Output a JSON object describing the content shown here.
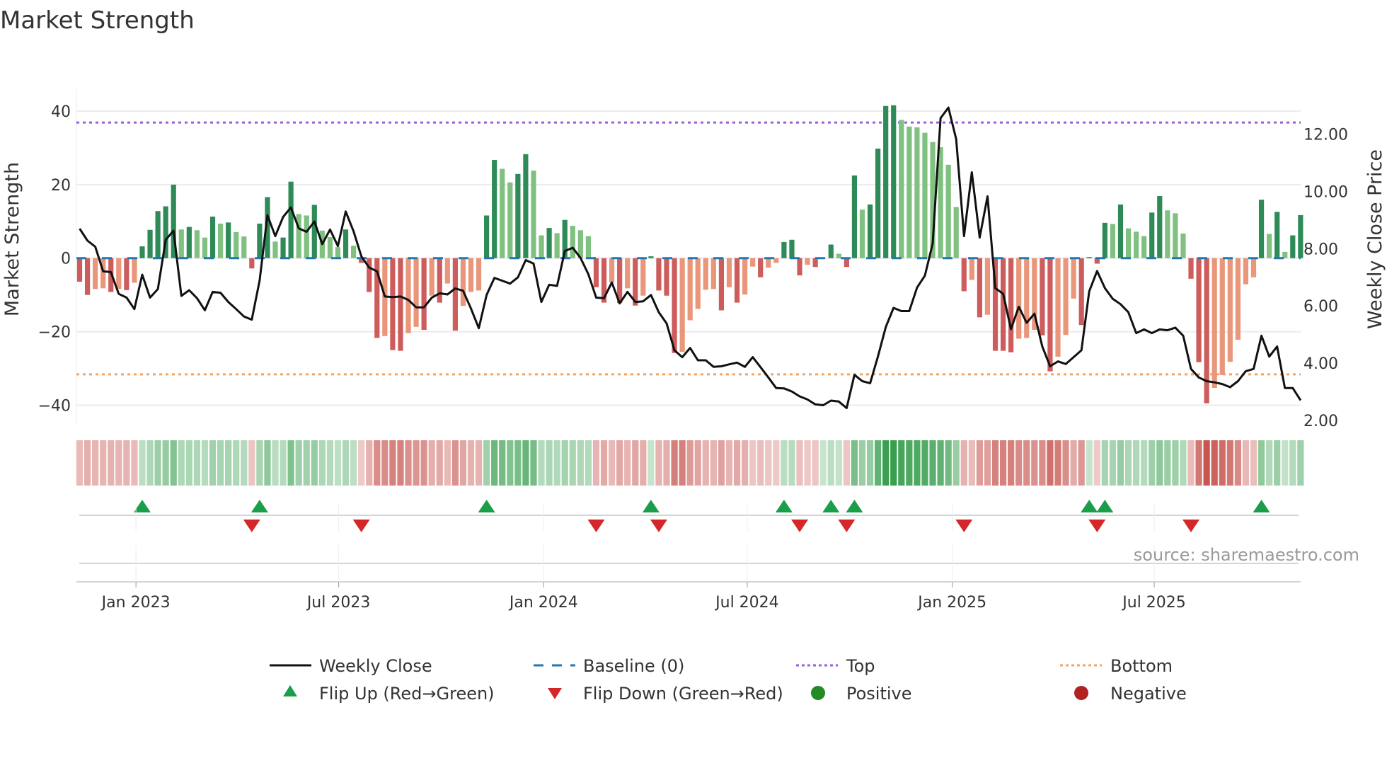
{
  "chart_data": {
    "type": "bar",
    "title": "Market Strength",
    "ylabel": "Market Strength",
    "y2label": "Weekly Close Price",
    "ylim": [
      -45.3,
      45
    ],
    "y2lim": [
      1.85,
      13.45
    ],
    "yticks": [
      {
        "value": 40,
        "label": "40"
      },
      {
        "value": 20,
        "label": "20"
      },
      {
        "value": 0,
        "label": "0"
      },
      {
        "value": -20,
        "label": "−20"
      },
      {
        "value": -40,
        "label": "−40"
      }
    ],
    "y2ticks": [
      {
        "value": 2,
        "label": "2.00"
      },
      {
        "value": 4,
        "label": "4.00"
      },
      {
        "value": 6,
        "label": "6.00"
      },
      {
        "value": 8,
        "label": "8.00"
      },
      {
        "value": 10,
        "label": "10.00"
      },
      {
        "value": 12,
        "label": "12.00"
      }
    ],
    "xticks": [
      {
        "week": 7.2,
        "label": "Jan 2023"
      },
      {
        "week": 33.1,
        "label": "Jul 2023"
      },
      {
        "week": 59.3,
        "label": "Jan 2024"
      },
      {
        "week": 85.3,
        "label": "Jul 2024"
      },
      {
        "week": 111.5,
        "label": "Jan 2025"
      },
      {
        "week": 137.3,
        "label": "Jul 2025"
      }
    ],
    "grid": true,
    "baseline": 0,
    "top_level": 36.9,
    "bottom_level": -31.6,
    "strength": [
      -6.4,
      -10,
      -8.4,
      -8.2,
      -9.2,
      -8.4,
      -8.7,
      -6.7,
      3.2,
      7.7,
      12.8,
      14.1,
      20,
      7.8,
      8.5,
      7.6,
      5.6,
      11.3,
      9.4,
      9.7,
      7.1,
      5.9,
      -2.8,
      9.4,
      16.6,
      4.5,
      5.6,
      20.8,
      12,
      11.6,
      14.5,
      7.5,
      5.7,
      3,
      7.8,
      3.4,
      -1.3,
      -9.2,
      -21.7,
      -21.2,
      -25,
      -25.2,
      -20.4,
      -18.7,
      -19.5,
      -10.2,
      -12.1,
      -6.9,
      -19.7,
      -13,
      -9.2,
      -8.8,
      11.6,
      26.7,
      24.3,
      20.6,
      22.9,
      28.3,
      23.8,
      6.2,
      8.2,
      6.8,
      10.4,
      8.8,
      7.6,
      6,
      -7.9,
      -12.1,
      -6.6,
      -12.2,
      -8.2,
      -12.9,
      -10.2,
      0.5,
      -8.8,
      -10.2,
      -25.8,
      -25.5,
      -16.9,
      -13.8,
      -8.6,
      -8.4,
      -14.2,
      -7.9,
      -12.1,
      -9.9,
      -2.3,
      -5.2,
      -2.6,
      -1.3,
      4.4,
      5,
      -4.7,
      -1.8,
      -2.4,
      0,
      3.7,
      1.2,
      -2.4,
      22.5,
      13.2,
      14.6,
      29.8,
      41.4,
      41.6,
      37.6,
      35.8,
      35.6,
      34.1,
      31.6,
      30.2,
      25.4,
      13.9,
      -9,
      -5.9,
      -16.1,
      -15.4,
      -25.2,
      -25.2,
      -25.6,
      -21.9,
      -21.7,
      -19.5,
      -21,
      -30.8,
      -26.8,
      -20.9,
      -11,
      -18.2,
      0.3,
      -1.5,
      9.6,
      9.3,
      14.6,
      8.1,
      7.2,
      6,
      12.4,
      16.9,
      13,
      12.2,
      6.7,
      -5.6,
      -28.3,
      -39.5,
      -35.3,
      -31.8,
      -28.2,
      -22.2,
      -7.1,
      -5.2,
      15.9,
      6.6,
      12.6,
      1.7,
      6.2,
      11.7
    ],
    "weekly_close": [
      8.7,
      8.28,
      8.07,
      7.21,
      7.18,
      6.42,
      6.29,
      5.89,
      7.09,
      6.29,
      6.59,
      8.31,
      8.63,
      6.35,
      6.55,
      6.27,
      5.85,
      6.49,
      6.46,
      6.14,
      5.89,
      5.63,
      5.52,
      6.89,
      9.17,
      8.44,
      9.11,
      9.44,
      8.71,
      8.59,
      8.95,
      8.16,
      8.67,
      8.09,
      9.3,
      8.61,
      7.73,
      7.34,
      7.21,
      6.33,
      6.31,
      6.33,
      6.21,
      5.95,
      5.95,
      6.29,
      6.44,
      6.4,
      6.61,
      6.53,
      5.91,
      5.22,
      6.38,
      6.98,
      6.88,
      6.78,
      7.0,
      7.6,
      7.48,
      6.14,
      6.74,
      6.7,
      7.92,
      8.03,
      7.68,
      7.11,
      6.29,
      6.27,
      6.82,
      6.09,
      6.49,
      6.14,
      6.16,
      6.38,
      5.78,
      5.39,
      4.45,
      4.21,
      4.53,
      4.1,
      4.1,
      3.87,
      3.89,
      3.96,
      4.02,
      3.87,
      4.21,
      3.86,
      3.5,
      3.13,
      3.12,
      3.01,
      2.84,
      2.73,
      2.56,
      2.53,
      2.69,
      2.66,
      2.43,
      3.59,
      3.37,
      3.3,
      4.23,
      5.26,
      5.93,
      5.82,
      5.82,
      6.64,
      7.06,
      8.18,
      12.56,
      12.93,
      11.83,
      8.44,
      10.67,
      8.39,
      9.83,
      6.62,
      6.42,
      5.19,
      5.97,
      5.41,
      5.73,
      4.58,
      3.89,
      4.06,
      3.97,
      4.21,
      4.45,
      6.51,
      7.22,
      6.62,
      6.25,
      6.06,
      5.78,
      5.05,
      5.18,
      5.05,
      5.18,
      5.15,
      5.24,
      4.96,
      3.8,
      3.5,
      3.37,
      3.33,
      3.27,
      3.16,
      3.37,
      3.72,
      3.8,
      4.96,
      4.23,
      4.58,
      3.13,
      3.13,
      2.7
    ],
    "legend": {
      "weekly_close": "Weekly Close",
      "baseline": "Baseline (0)",
      "top": "Top",
      "bottom": "Bottom",
      "flip_up": "Flip Up (Red→Green)",
      "flip_down": "Flip Down (Green→Red)",
      "positive": "Positive",
      "negative": "Negative"
    },
    "legend_placement": "bottom",
    "source": "source: sharemaestro.com"
  },
  "colors": {
    "pos_up": "#2e8b57",
    "pos_down": "#80c080",
    "neg_down": "#cd5c5c",
    "neg_up": "#e9967a",
    "line": "#111111",
    "baseline": "#1f77b4",
    "top": "#9a5fdc",
    "bottom": "#f4a460",
    "flip_up": "#1a9e4a",
    "flip_down": "#d62728",
    "positive": "#228b22",
    "negative": "#b22222"
  }
}
